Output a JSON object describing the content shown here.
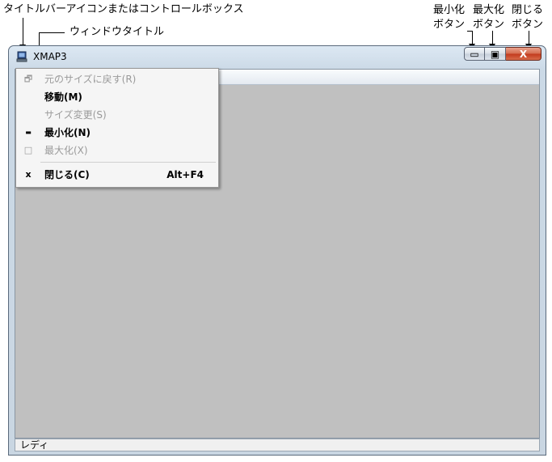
{
  "annotations": {
    "titlebar_icon": "タイトルバーアイコンまたはコントロールボックス",
    "window_title": "ウィンドウタイトル",
    "minimize_line1": "最小化",
    "minimize_line2": "ボタン",
    "maximize_line1": "最大化",
    "maximize_line2": "ボタン",
    "close_line1": "閉じる",
    "close_line2": "ボタン"
  },
  "window": {
    "title": "XMAP3",
    "app_icon": "computer-icon"
  },
  "system_menu": {
    "items": [
      {
        "label": "元のサイズに戻す(R)",
        "icon": "restore-icon",
        "glyph": "🗗",
        "enabled": false
      },
      {
        "label": "移動(M)",
        "icon": "",
        "glyph": "",
        "enabled": true
      },
      {
        "label": "サイズ変更(S)",
        "icon": "",
        "glyph": "",
        "enabled": false
      },
      {
        "label": "最小化(N)",
        "icon": "minimize-icon",
        "glyph": "▬",
        "enabled": true
      },
      {
        "label": "最大化(X)",
        "icon": "maximize-icon",
        "glyph": "□",
        "enabled": false
      },
      {
        "label": "閉じる(C)",
        "icon": "close-icon",
        "glyph": "x",
        "enabled": true,
        "accelerator": "Alt+F4"
      }
    ]
  },
  "caption_buttons": {
    "minimize_glyph": "▭",
    "maximize_glyph": "▣",
    "close_glyph": "X"
  },
  "status_bar": {
    "text": "レディ"
  }
}
